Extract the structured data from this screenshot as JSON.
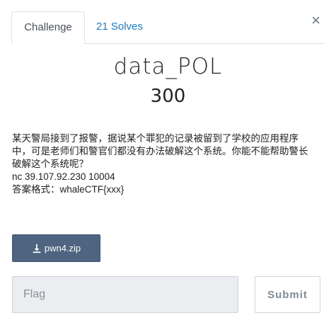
{
  "tabs": {
    "challenge": "Challenge",
    "solves": "21 Solves"
  },
  "close_symbol": "×",
  "challenge": {
    "name": "data_POL",
    "points": "300",
    "description": [
      "某天警局接到了报警，据说某个罪犯的记录被留到了学校的应用程序中，可是老师们和警官们都没有办法破解这个系统。你能不能帮助警长破解这个系统呢？",
      "nc 39.107.92.230 10004",
      "答案格式：whaleCTF{xxx}"
    ]
  },
  "download": {
    "icon": "download-icon",
    "label": "pwn4.zip"
  },
  "flag_input": {
    "placeholder": "Flag",
    "value": ""
  },
  "submit_label": "Submit",
  "colors": {
    "link": "#1e7bc0",
    "download_bg": "#4e6480",
    "input_bg": "#ebedf0"
  }
}
